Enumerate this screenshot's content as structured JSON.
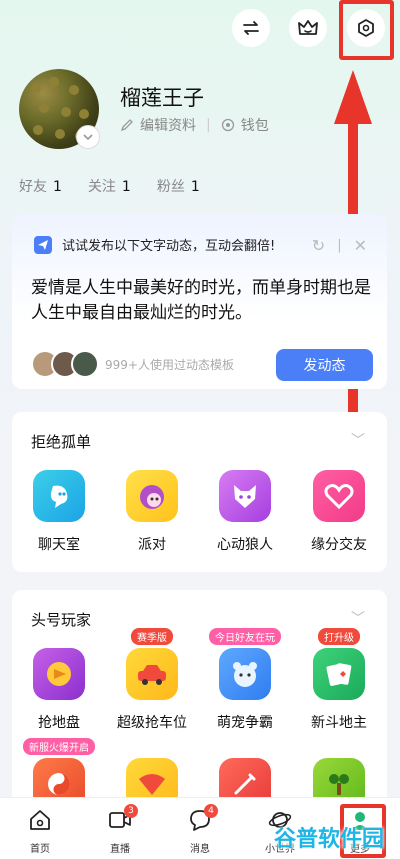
{
  "profile": {
    "username": "榴莲王子",
    "edit_label": "编辑资料",
    "wallet_label": "钱包"
  },
  "stats": [
    {
      "label": "好友",
      "value": "1"
    },
    {
      "label": "关注",
      "value": "1"
    },
    {
      "label": "粉丝",
      "value": "1"
    }
  ],
  "post_card": {
    "tip": "试试发布以下文字动态，互动会翻倍!",
    "text": "爱情是人生中最美好的时光，而单身时期也是人生中最自由最灿烂的时光。",
    "template_count": "999+人使用过动态模板",
    "post_button": "发动态"
  },
  "section1": {
    "title": "拒绝孤单",
    "items": [
      {
        "label": "聊天室"
      },
      {
        "label": "派对"
      },
      {
        "label": "心动狼人"
      },
      {
        "label": "缘分交友"
      }
    ]
  },
  "section2": {
    "title": "头号玩家",
    "items": [
      {
        "label": "抢地盘",
        "tag": ""
      },
      {
        "label": "超级抢车位",
        "tag": "赛季版"
      },
      {
        "label": "萌宠争霸",
        "tag": "今日好友在玩"
      },
      {
        "label": "新斗地主",
        "tag": "打升级"
      }
    ],
    "row2_tag": "新服火爆开启"
  },
  "bottom_nav": [
    {
      "label": "首页",
      "badge": ""
    },
    {
      "label": "直播",
      "badge": "3"
    },
    {
      "label": "消息",
      "badge": "4"
    },
    {
      "label": "小世界",
      "badge": ""
    },
    {
      "label": "更多",
      "badge": ""
    }
  ],
  "watermark": "谷普软件园",
  "colors": {
    "accent": "#4a7ff7",
    "highlight": "#e8352b",
    "badge": "#f04a3c"
  }
}
